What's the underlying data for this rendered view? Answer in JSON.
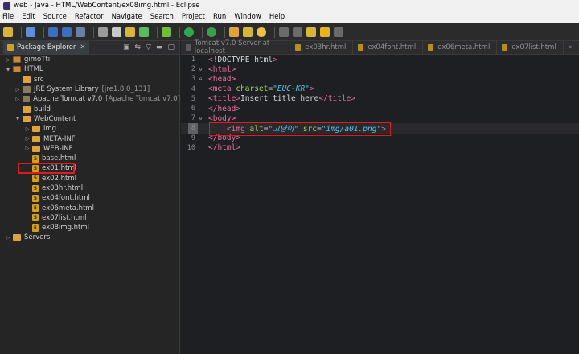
{
  "window": {
    "title": "web - Java - HTML/WebContent/ex08img.html - Eclipse"
  },
  "menu": [
    "File",
    "Edit",
    "Source",
    "Refactor",
    "Navigate",
    "Search",
    "Project",
    "Run",
    "Window",
    "Help"
  ],
  "package_explorer": {
    "tab_label": "Package Explorer",
    "tab_close": "✕",
    "tree": [
      {
        "label": "gimoTti",
        "decor": "",
        "level": 0,
        "icon": "project",
        "arrow": "right"
      },
      {
        "label": "HTML",
        "decor": "",
        "level": 0,
        "icon": "project",
        "arrow": "down"
      },
      {
        "label": "src",
        "decor": "",
        "level": 1,
        "icon": "folder",
        "arrow": ""
      },
      {
        "label": "JRE System Library",
        "decor": "[jre1.8.0_131]",
        "level": 1,
        "icon": "jar",
        "arrow": "right"
      },
      {
        "label": "Apache Tomcat v7.0",
        "decor": "[Apache Tomcat v7.0]",
        "level": 1,
        "icon": "jar",
        "arrow": "right"
      },
      {
        "label": "build",
        "decor": "",
        "level": 1,
        "icon": "folder",
        "arrow": ""
      },
      {
        "label": "WebContent",
        "decor": "",
        "level": 1,
        "icon": "folder",
        "arrow": "down"
      },
      {
        "label": "img",
        "decor": "",
        "level": 2,
        "icon": "folder",
        "arrow": "right"
      },
      {
        "label": "META-INF",
        "decor": "",
        "level": 2,
        "icon": "folder",
        "arrow": "right"
      },
      {
        "label": "WEB-INF",
        "decor": "",
        "level": 2,
        "icon": "folder",
        "arrow": "right"
      },
      {
        "label": "base.html",
        "decor": "",
        "level": 2,
        "icon": "html5",
        "arrow": ""
      },
      {
        "label": "ex01.html",
        "decor": "",
        "level": 2,
        "icon": "html5",
        "arrow": ""
      },
      {
        "label": "ex02.html",
        "decor": "",
        "level": 2,
        "icon": "html5",
        "arrow": ""
      },
      {
        "label": "ex03hr.html",
        "decor": "",
        "level": 2,
        "icon": "html5",
        "arrow": ""
      },
      {
        "label": "ex04font.html",
        "decor": "",
        "level": 2,
        "icon": "html5",
        "arrow": ""
      },
      {
        "label": "ex06meta.html",
        "decor": "",
        "level": 2,
        "icon": "html5",
        "arrow": ""
      },
      {
        "label": "ex07list.html",
        "decor": "",
        "level": 2,
        "icon": "html5",
        "arrow": ""
      },
      {
        "label": "ex08img.html",
        "decor": "",
        "level": 2,
        "icon": "html5",
        "arrow": ""
      },
      {
        "label": "Servers",
        "decor": "",
        "level": 0,
        "icon": "folder",
        "arrow": "right"
      }
    ]
  },
  "editor": {
    "tabs": [
      {
        "label": "Tomcat v7.0 Server at localhost",
        "icon": "srv"
      },
      {
        "label": "ex03hr.html",
        "icon": "html"
      },
      {
        "label": "ex04font.html",
        "icon": "html"
      },
      {
        "label": "ex06meta.html",
        "icon": "html"
      },
      {
        "label": "ex07list.html",
        "icon": "html"
      }
    ],
    "more": "»",
    "lines": [
      {
        "num": "1",
        "fold": "",
        "tokens": [
          [
            "bracket",
            "<!"
          ],
          [
            "doctype",
            "DOCTYPE html"
          ],
          [
            "bracket",
            ">"
          ]
        ]
      },
      {
        "num": "2",
        "fold": "⊖",
        "tokens": [
          [
            "bracket",
            "<"
          ],
          [
            "tag",
            "html"
          ],
          [
            "bracket",
            ">"
          ]
        ]
      },
      {
        "num": "3",
        "fold": "⊖",
        "tokens": [
          [
            "bracket",
            "<"
          ],
          [
            "tag",
            "head"
          ],
          [
            "bracket",
            ">"
          ]
        ]
      },
      {
        "num": "4",
        "fold": "",
        "tokens": [
          [
            "bracket",
            "<"
          ],
          [
            "tag",
            "meta"
          ],
          [
            "txt",
            " "
          ],
          [
            "attr",
            "charset"
          ],
          [
            "txt",
            "="
          ],
          [
            "val",
            "\"EUC-KR\""
          ],
          [
            "bracket",
            ">"
          ]
        ]
      },
      {
        "num": "5",
        "fold": "",
        "tokens": [
          [
            "bracket",
            "<"
          ],
          [
            "tag",
            "title"
          ],
          [
            "bracket",
            ">"
          ],
          [
            "txt",
            "Insert title here"
          ],
          [
            "bracket",
            "</"
          ],
          [
            "tag",
            "title"
          ],
          [
            "bracket",
            ">"
          ]
        ]
      },
      {
        "num": "6",
        "fold": "",
        "tokens": [
          [
            "bracket",
            "</"
          ],
          [
            "tag",
            "head"
          ],
          [
            "bracket",
            ">"
          ]
        ]
      },
      {
        "num": "7",
        "fold": "⊖",
        "tokens": [
          [
            "bracket",
            "<"
          ],
          [
            "tag",
            "body"
          ],
          [
            "bracket",
            ">"
          ]
        ]
      },
      {
        "num": "8",
        "fold": "",
        "current": true,
        "tokens": [
          [
            "txt",
            "    "
          ],
          [
            "bracket",
            "<"
          ],
          [
            "tag",
            "img"
          ],
          [
            "txt",
            " "
          ],
          [
            "attr",
            "alt"
          ],
          [
            "txt",
            "="
          ],
          [
            "val",
            "\"고냥이\""
          ],
          [
            "txt",
            " "
          ],
          [
            "attr",
            "src"
          ],
          [
            "txt",
            "="
          ],
          [
            "val",
            "\"img/a01.png\""
          ],
          [
            "bracket",
            ">"
          ]
        ]
      },
      {
        "num": "9",
        "fold": "",
        "tokens": [
          [
            "bracket",
            "</"
          ],
          [
            "tag",
            "body"
          ],
          [
            "bracket",
            ">"
          ]
        ]
      },
      {
        "num": "10",
        "fold": "",
        "tokens": [
          [
            "bracket",
            "</"
          ],
          [
            "tag",
            "html"
          ],
          [
            "bracket",
            ">"
          ]
        ]
      }
    ]
  },
  "colors": {
    "highlight_box": "#e01b1b",
    "tag": "#e3719a",
    "attr": "#a6d35a",
    "value": "#56c2e6"
  }
}
